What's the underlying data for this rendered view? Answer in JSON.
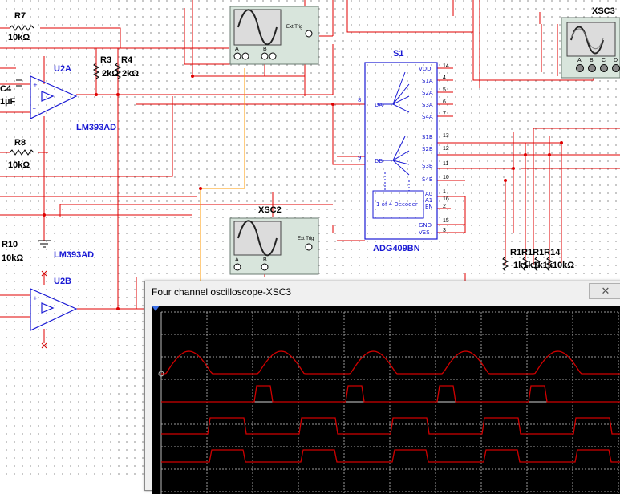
{
  "schematic": {
    "components": {
      "r7": {
        "ref": "R7",
        "value": "10kΩ"
      },
      "r3": {
        "ref": "R3",
        "value": "2kΩ"
      },
      "r4": {
        "ref": "R4",
        "value": "2kΩ"
      },
      "r8": {
        "ref": "R8",
        "value": "10kΩ"
      },
      "r10": {
        "ref": "R10",
        "value": "10kΩ"
      },
      "c4": {
        "ref": "C4",
        "value": "1µF"
      },
      "u2a": {
        "ref": "U2A",
        "part": "LM393AD"
      },
      "u2b": {
        "ref": "U2B",
        "part": "LM393AD"
      },
      "s1": {
        "ref": "S1",
        "part": "ADG409BN",
        "decoder": "1 of 4 Decoder",
        "pins_left": [
          "DA",
          "DB"
        ],
        "pins_right": [
          "VDD",
          "S1A",
          "S2A",
          "S3A",
          "S4A",
          "S1B",
          "S2B",
          "S3B",
          "S4B",
          "A0",
          "A1",
          "EN",
          "GND",
          "VSS"
        ],
        "pin_numbers": [
          "14",
          "4",
          "5",
          "6",
          "7",
          "13",
          "12",
          "11",
          "10",
          "1",
          "16",
          "2",
          "15",
          "3"
        ],
        "left_pin_numbers": [
          "8",
          "9"
        ]
      },
      "resistor_bank": {
        "refs": "R1R1R1R14",
        "values": "1k1k1k1k10kΩ"
      },
      "xsc2": {
        "ref": "XSC2"
      },
      "xsc3": {
        "ref": "XSC3"
      },
      "scope_inputs": {
        "a": "A",
        "b": "B",
        "c": "C",
        "d": "D",
        "ext": "Ext Trig",
        "pin_plus": "+",
        "pin_minus": "_"
      }
    },
    "colors": {
      "wire": "#e00000",
      "wire_orange": "#ff9a00",
      "label_blue": "#1a1ad4"
    }
  },
  "oscilloscope_window": {
    "title": "Four channel oscilloscope-XSC3",
    "close_icon": "close-icon",
    "screen": {
      "background": "#000000",
      "trace_color": "#d00000",
      "channels": [
        {
          "name": "A",
          "shape": "rectified-sine",
          "cycles": 5
        },
        {
          "name": "B",
          "shape": "narrow-pulse",
          "cycles": 4
        },
        {
          "name": "C",
          "shape": "wide-pulse",
          "cycles": 4
        },
        {
          "name": "D",
          "shape": "wide-pulse",
          "cycles": 4
        }
      ]
    }
  }
}
